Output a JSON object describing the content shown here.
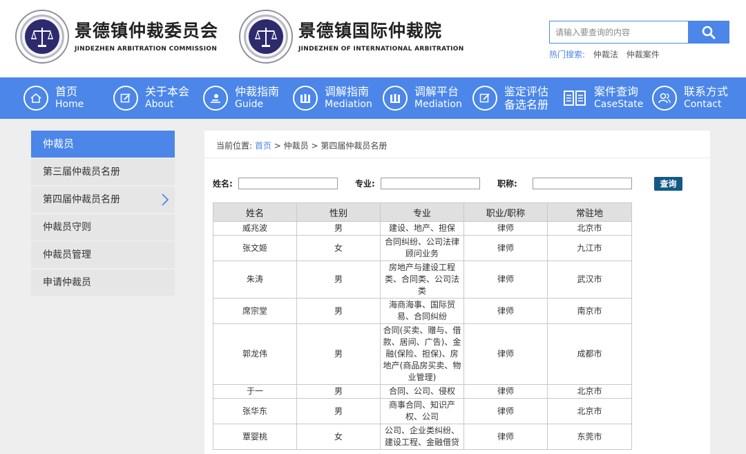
{
  "header": {
    "logo1": {
      "cn": "景德镇仲裁委员会",
      "en": "JINDEZHEN ARBITRATION COMMISSION"
    },
    "logo2": {
      "cn": "景德镇国际仲裁院",
      "en": "JINDEZHEN OF INTERNATIONAL ARBITRATION"
    },
    "search": {
      "placeholder": "请输入要查询的内容"
    },
    "hot": {
      "label": "热门搜索:",
      "links": [
        "仲裁法",
        "仲裁案件"
      ]
    }
  },
  "nav": [
    {
      "cn": "首页",
      "en": "Home",
      "icon": "home-icon"
    },
    {
      "cn": "关于本会",
      "en": "About",
      "icon": "edit-icon"
    },
    {
      "cn": "仲裁指南",
      "en": "Guide",
      "icon": "hand-icon"
    },
    {
      "cn": "调解指南",
      "en": "Mediation",
      "icon": "handshake-icon"
    },
    {
      "cn": "调解平台",
      "en": "Mediation",
      "icon": "handshake-icon"
    },
    {
      "cn": "鉴定评估",
      "en": "备选名册",
      "icon": "edit-icon"
    },
    {
      "cn": "案件查询",
      "en": "CaseState",
      "icon": "book-icon"
    },
    {
      "cn": "联系方式",
      "en": "Contact",
      "icon": "people-icon"
    }
  ],
  "sidebar": {
    "title": "仲裁员",
    "items": [
      "第三届仲裁员名册",
      "第四届仲裁员名册",
      "仲裁员守则",
      "仲裁员管理",
      "申请仲裁员"
    ]
  },
  "breadcrumb": {
    "prefix": "当前位置:",
    "home": "首页",
    "sep": ">",
    "level1": "仲裁员",
    "level2": "第四届仲裁员名册"
  },
  "filters": {
    "name_label": "姓名:",
    "specialty_label": "专业:",
    "title_label": "职称:",
    "query_button": "查询"
  },
  "table": {
    "headers": [
      "姓名",
      "性别",
      "专业",
      "职业/职称",
      "常驻地"
    ],
    "rows": [
      {
        "name": "威兆波",
        "gender": "男",
        "specialty": "建设、地产、担保",
        "title": "律师",
        "location": "北京市"
      },
      {
        "name": "张文姬",
        "gender": "女",
        "specialty": "合同纠纷、公司法律顾问业务",
        "title": "律师",
        "location": "九江市"
      },
      {
        "name": "朱涛",
        "gender": "男",
        "specialty": "房地产与建设工程类、合同类、公司法类",
        "title": "律师",
        "location": "武汉市"
      },
      {
        "name": "席宗堂",
        "gender": "男",
        "specialty": "海商海事、国际贸易、合同纠纷",
        "title": "律师",
        "location": "南京市"
      },
      {
        "name": "郭龙伟",
        "gender": "男",
        "specialty": "合同(买卖、赠与、借款、居间、广告)、金融(保险、担保)、房地产(商品房买卖、物业管理)",
        "title": "律师",
        "location": "成都市"
      },
      {
        "name": "于一",
        "gender": "男",
        "specialty": "合同、公司、侵权",
        "title": "律师",
        "location": "北京市"
      },
      {
        "name": "张华东",
        "gender": "男",
        "specialty": "商事合同、知识产权、公司",
        "title": "律师",
        "location": "北京市"
      },
      {
        "name": "覃婴桃",
        "gender": "女",
        "specialty": "公司、企业类纠纷、建设工程、金融借贷",
        "title": "律师",
        "location": "东莞市"
      }
    ]
  }
}
